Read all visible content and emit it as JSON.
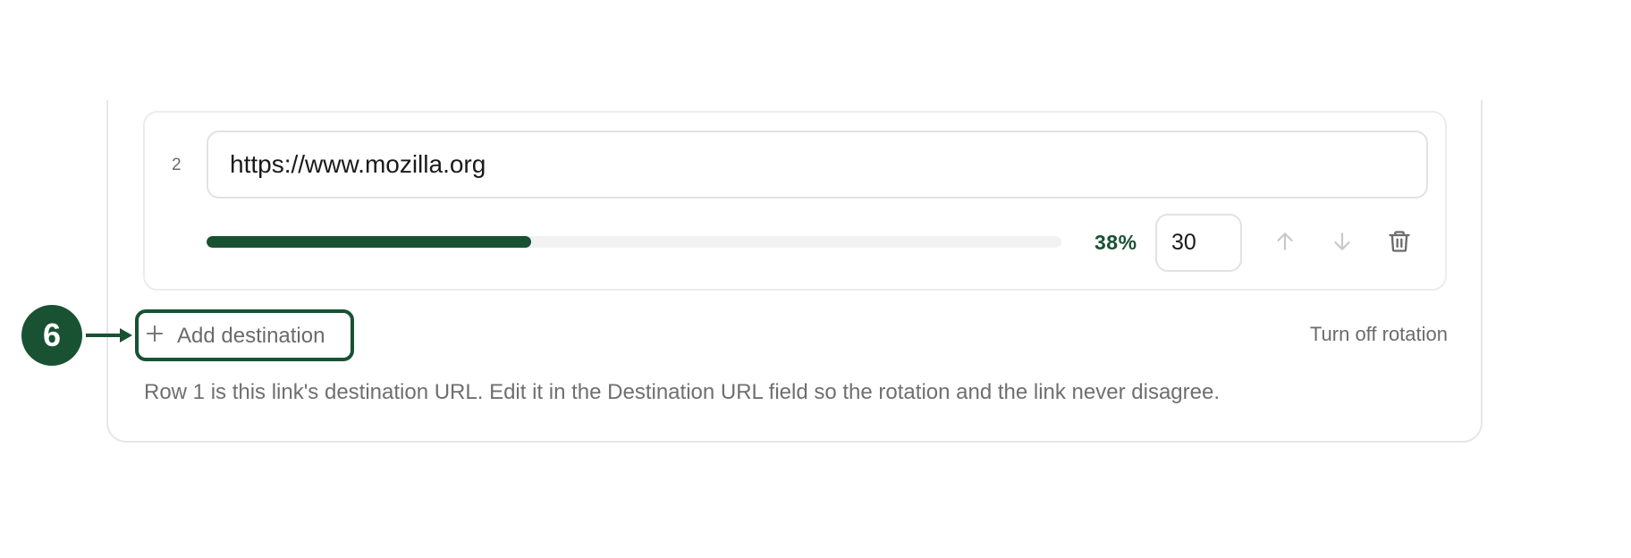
{
  "destinations": [
    {
      "index": "2",
      "url": "https://www.mozilla.org",
      "weight_percent_label": "38%",
      "weight_fraction": 0.38,
      "weight_value": "30",
      "actions": {
        "move_up_icon": "arrow-up-icon",
        "move_down_icon": "arrow-down-icon",
        "delete_icon": "trash-icon"
      }
    }
  ],
  "controls": {
    "add_destination_label": "Add destination",
    "add_icon": "plus-icon",
    "turn_off_rotation_label": "Turn off rotation"
  },
  "help_text": "Row 1 is this link's destination URL. Edit it in the Destination URL field so the rotation and the link never disagree.",
  "callout": {
    "step_number": "6"
  },
  "colors": {
    "accent": "#195233",
    "muted_text": "#6b6b6b",
    "border": "#e2e2e2",
    "track": "#f2f2f2",
    "disabled_icon": "#c8c8c8"
  }
}
